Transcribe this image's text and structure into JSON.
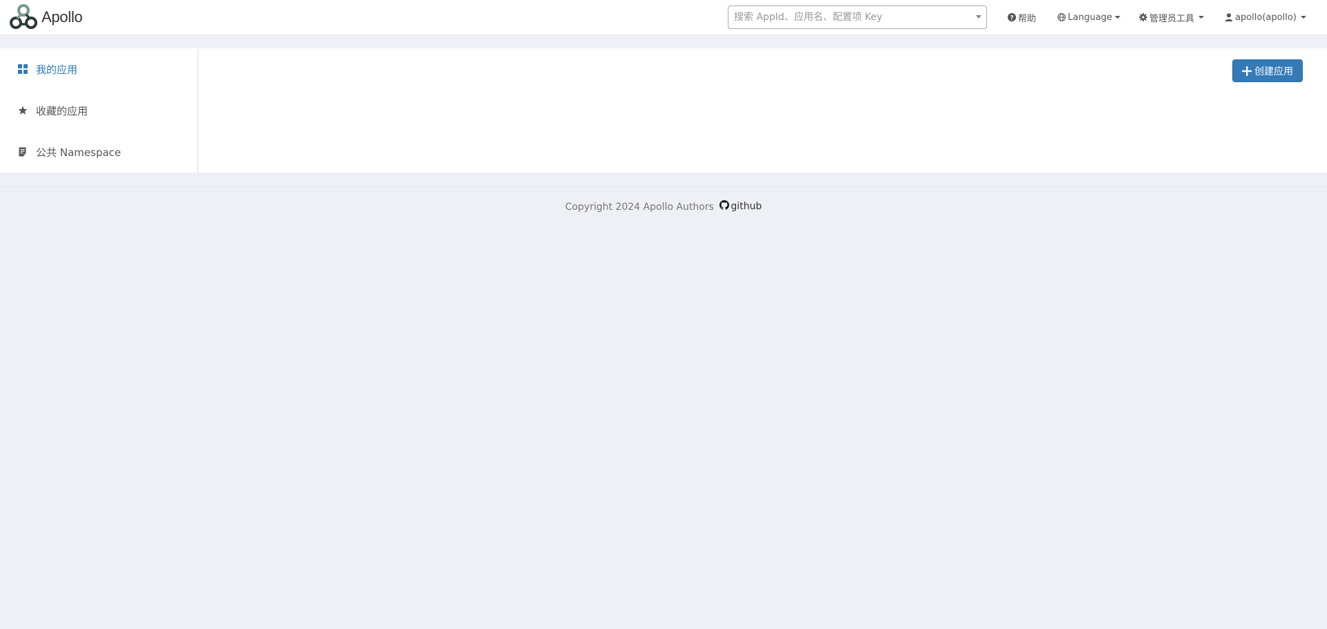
{
  "brand": {
    "name": "Apollo",
    "logo_icon": "apollo-logo-icon"
  },
  "header": {
    "search": {
      "placeholder": "搜索 AppId、应用名、配置项 Key",
      "value": ""
    },
    "help_label": "帮助",
    "language_label": "Language",
    "admin_tools_label": "管理员工具",
    "user_label": "apollo(apollo)"
  },
  "sidebar": {
    "items": [
      {
        "label": "我的应用",
        "icon": "grid-icon",
        "active": true
      },
      {
        "label": "收藏的应用",
        "icon": "star-icon",
        "active": false
      },
      {
        "label": "公共 Namespace",
        "icon": "document-icon",
        "active": false
      }
    ]
  },
  "main": {
    "create_app_label": "创建应用"
  },
  "footer": {
    "copyright": "Copyright 2024 Apollo Authors",
    "github_label": "github"
  },
  "colors": {
    "accent": "#337ab7",
    "page_background": "#eff0f5",
    "panel_background": "#ffffff"
  }
}
